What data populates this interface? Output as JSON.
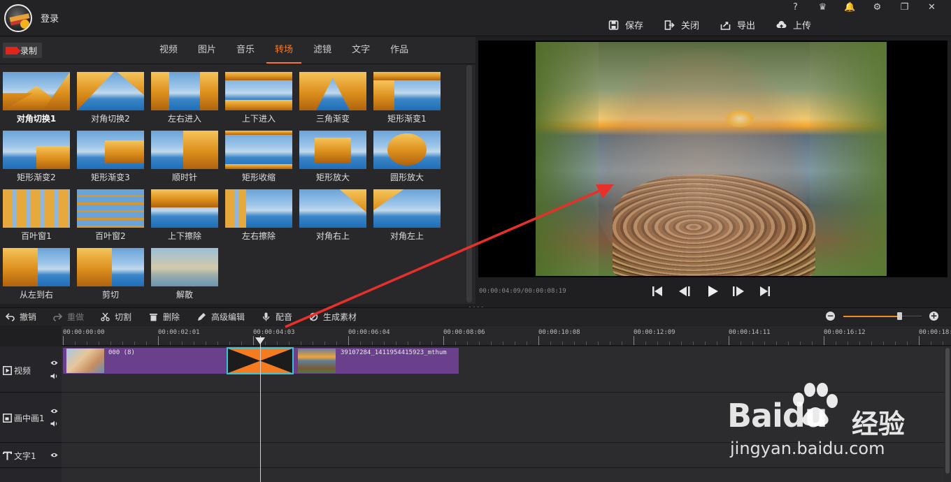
{
  "app": {
    "login": "登录"
  },
  "window_buttons": [
    "?",
    "♛",
    "🔔",
    "⚙",
    "❐",
    "✕"
  ],
  "actions": [
    {
      "label": "保存",
      "icon": "save-icon"
    },
    {
      "label": "关闭",
      "icon": "close-project-icon"
    },
    {
      "label": "导出",
      "icon": "export-icon"
    },
    {
      "label": "上传",
      "icon": "upload-icon"
    }
  ],
  "record": {
    "label": "录制"
  },
  "tabs": [
    {
      "label": "视频",
      "active": false
    },
    {
      "label": "图片",
      "active": false
    },
    {
      "label": "音乐",
      "active": false
    },
    {
      "label": "转场",
      "active": true
    },
    {
      "label": "滤镜",
      "active": false
    },
    {
      "label": "文字",
      "active": false
    },
    {
      "label": "作品",
      "active": false
    }
  ],
  "transitions": [
    "对角切换1",
    "对角切换2",
    "左右进入",
    "上下进入",
    "三角渐变",
    "矩形渐变1",
    "矩形渐变2",
    "矩形渐变3",
    "顺时针",
    "矩形收缩",
    "矩形放大",
    "圆形放大",
    "百叶窗1",
    "百叶窗2",
    "上下擦除",
    "左右擦除",
    "对角右上",
    "对角左上",
    "从左到右",
    "剪切",
    "解散"
  ],
  "preview": {
    "time": "00:00:04:09/00:00:08:19"
  },
  "toolbar": [
    {
      "label": "撤销",
      "icon": "undo-icon",
      "enabled": true
    },
    {
      "label": "重做",
      "icon": "redo-icon",
      "enabled": false
    },
    {
      "label": "切割",
      "icon": "scissors-icon",
      "enabled": true
    },
    {
      "label": "删除",
      "icon": "trash-icon",
      "enabled": true
    },
    {
      "label": "高级编辑",
      "icon": "pen-icon",
      "enabled": true
    },
    {
      "label": "配音",
      "icon": "microphone-icon",
      "enabled": true
    },
    {
      "label": "生成素材",
      "icon": "generate-icon",
      "enabled": true
    }
  ],
  "zoom": {
    "level": 0.72
  },
  "ruler": [
    "00:00:00:00",
    "00:00:02:01",
    "00:00:04:03",
    "00:00:06:04",
    "00:00:08:06",
    "00:00:10:08",
    "00:00:12:09",
    "00:00:14:11",
    "00:00:16:12",
    "00:00:18:"
  ],
  "lanes": [
    {
      "name": "视频",
      "icon": "play-box-icon"
    },
    {
      "name": "画中画1",
      "icon": "pip-icon"
    },
    {
      "name": "文字1",
      "icon": "text-icon"
    }
  ],
  "clips": [
    {
      "name": "000 (8)"
    },
    {
      "name": "39107284_1411954415923_mthum"
    }
  ],
  "watermark": {
    "brand": "Bai",
    "brand_du": "du",
    "cn": "经验",
    "url": "jingyan.baidu.com"
  },
  "colors": {
    "accent": "#ff7a1a",
    "clip": "#6a3f8c",
    "transition": "#f47b20",
    "transition_border": "#39c4d6",
    "arrow": "#e8302a"
  }
}
